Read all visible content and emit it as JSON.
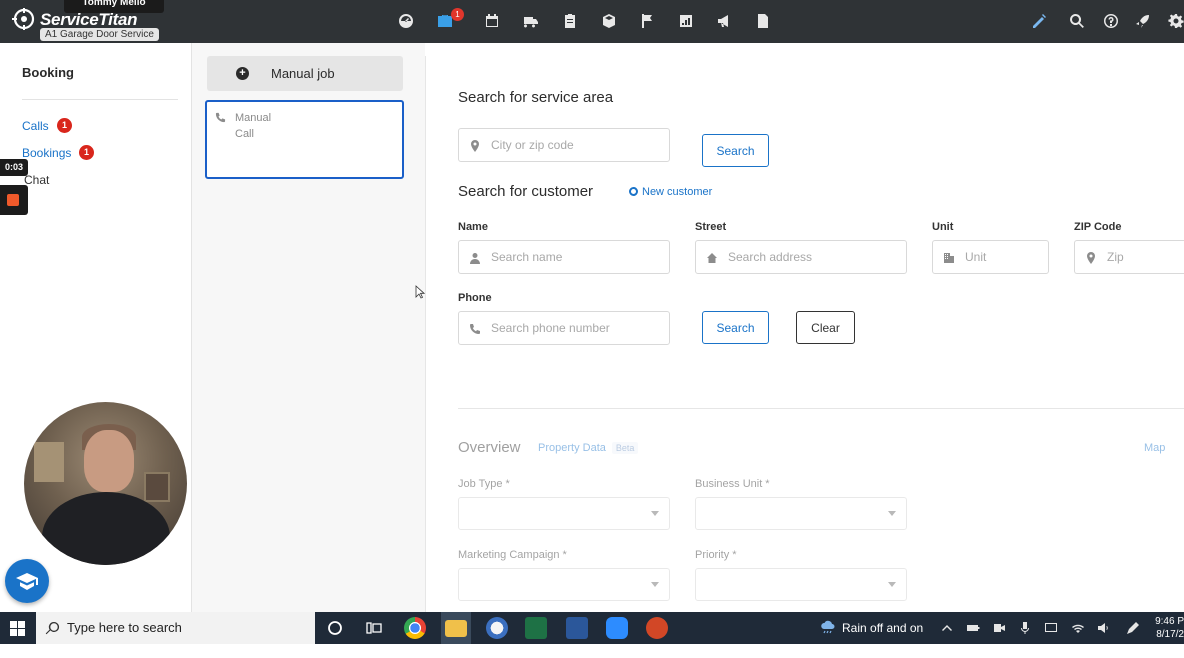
{
  "app": {
    "brand": "ServiceTitan",
    "company": "A1 Garage Door Service",
    "user": "Tommy Mello",
    "nav_badge_count": "1"
  },
  "sidebar": {
    "title": "Booking",
    "items": [
      {
        "label": "Calls",
        "count": "1"
      },
      {
        "label": "Bookings",
        "count": "1"
      },
      {
        "label": "Chat"
      }
    ]
  },
  "recording": {
    "timer": "0:03"
  },
  "middle": {
    "manual_job_label": "Manual job",
    "call_card": {
      "line1": "Manual",
      "line2": "Call"
    }
  },
  "service_area": {
    "title": "Search for service area",
    "input_placeholder": "City or zip code",
    "search_label": "Search"
  },
  "customer": {
    "title": "Search for customer",
    "new_customer_label": "New customer",
    "fields": {
      "name": {
        "label": "Name",
        "placeholder": "Search name"
      },
      "street": {
        "label": "Street",
        "placeholder": "Search address"
      },
      "unit": {
        "label": "Unit",
        "placeholder": "Unit"
      },
      "zip": {
        "label": "ZIP Code",
        "placeholder": "Zip"
      },
      "phone": {
        "label": "Phone",
        "placeholder": "Search phone number"
      }
    },
    "search_label": "Search",
    "clear_label": "Clear"
  },
  "overview": {
    "title": "Overview",
    "property_data_label": "Property Data",
    "beta_label": "Beta",
    "map_label": "Map",
    "job_type_label": "Job Type *",
    "business_unit_label": "Business Unit *",
    "marketing_campaign_label": "Marketing Campaign *",
    "priority_label": "Priority *"
  },
  "taskbar": {
    "search_placeholder": "Type here to search",
    "weather_text": "Rain off and on",
    "time": "9:46 P",
    "date": "8/17/2"
  },
  "colors": {
    "topbar": "#2f3336",
    "accent": "#1a73c8",
    "badge": "#d9261c",
    "selected_card_border": "#1a5fc8",
    "taskbar": "#1f2a38"
  }
}
